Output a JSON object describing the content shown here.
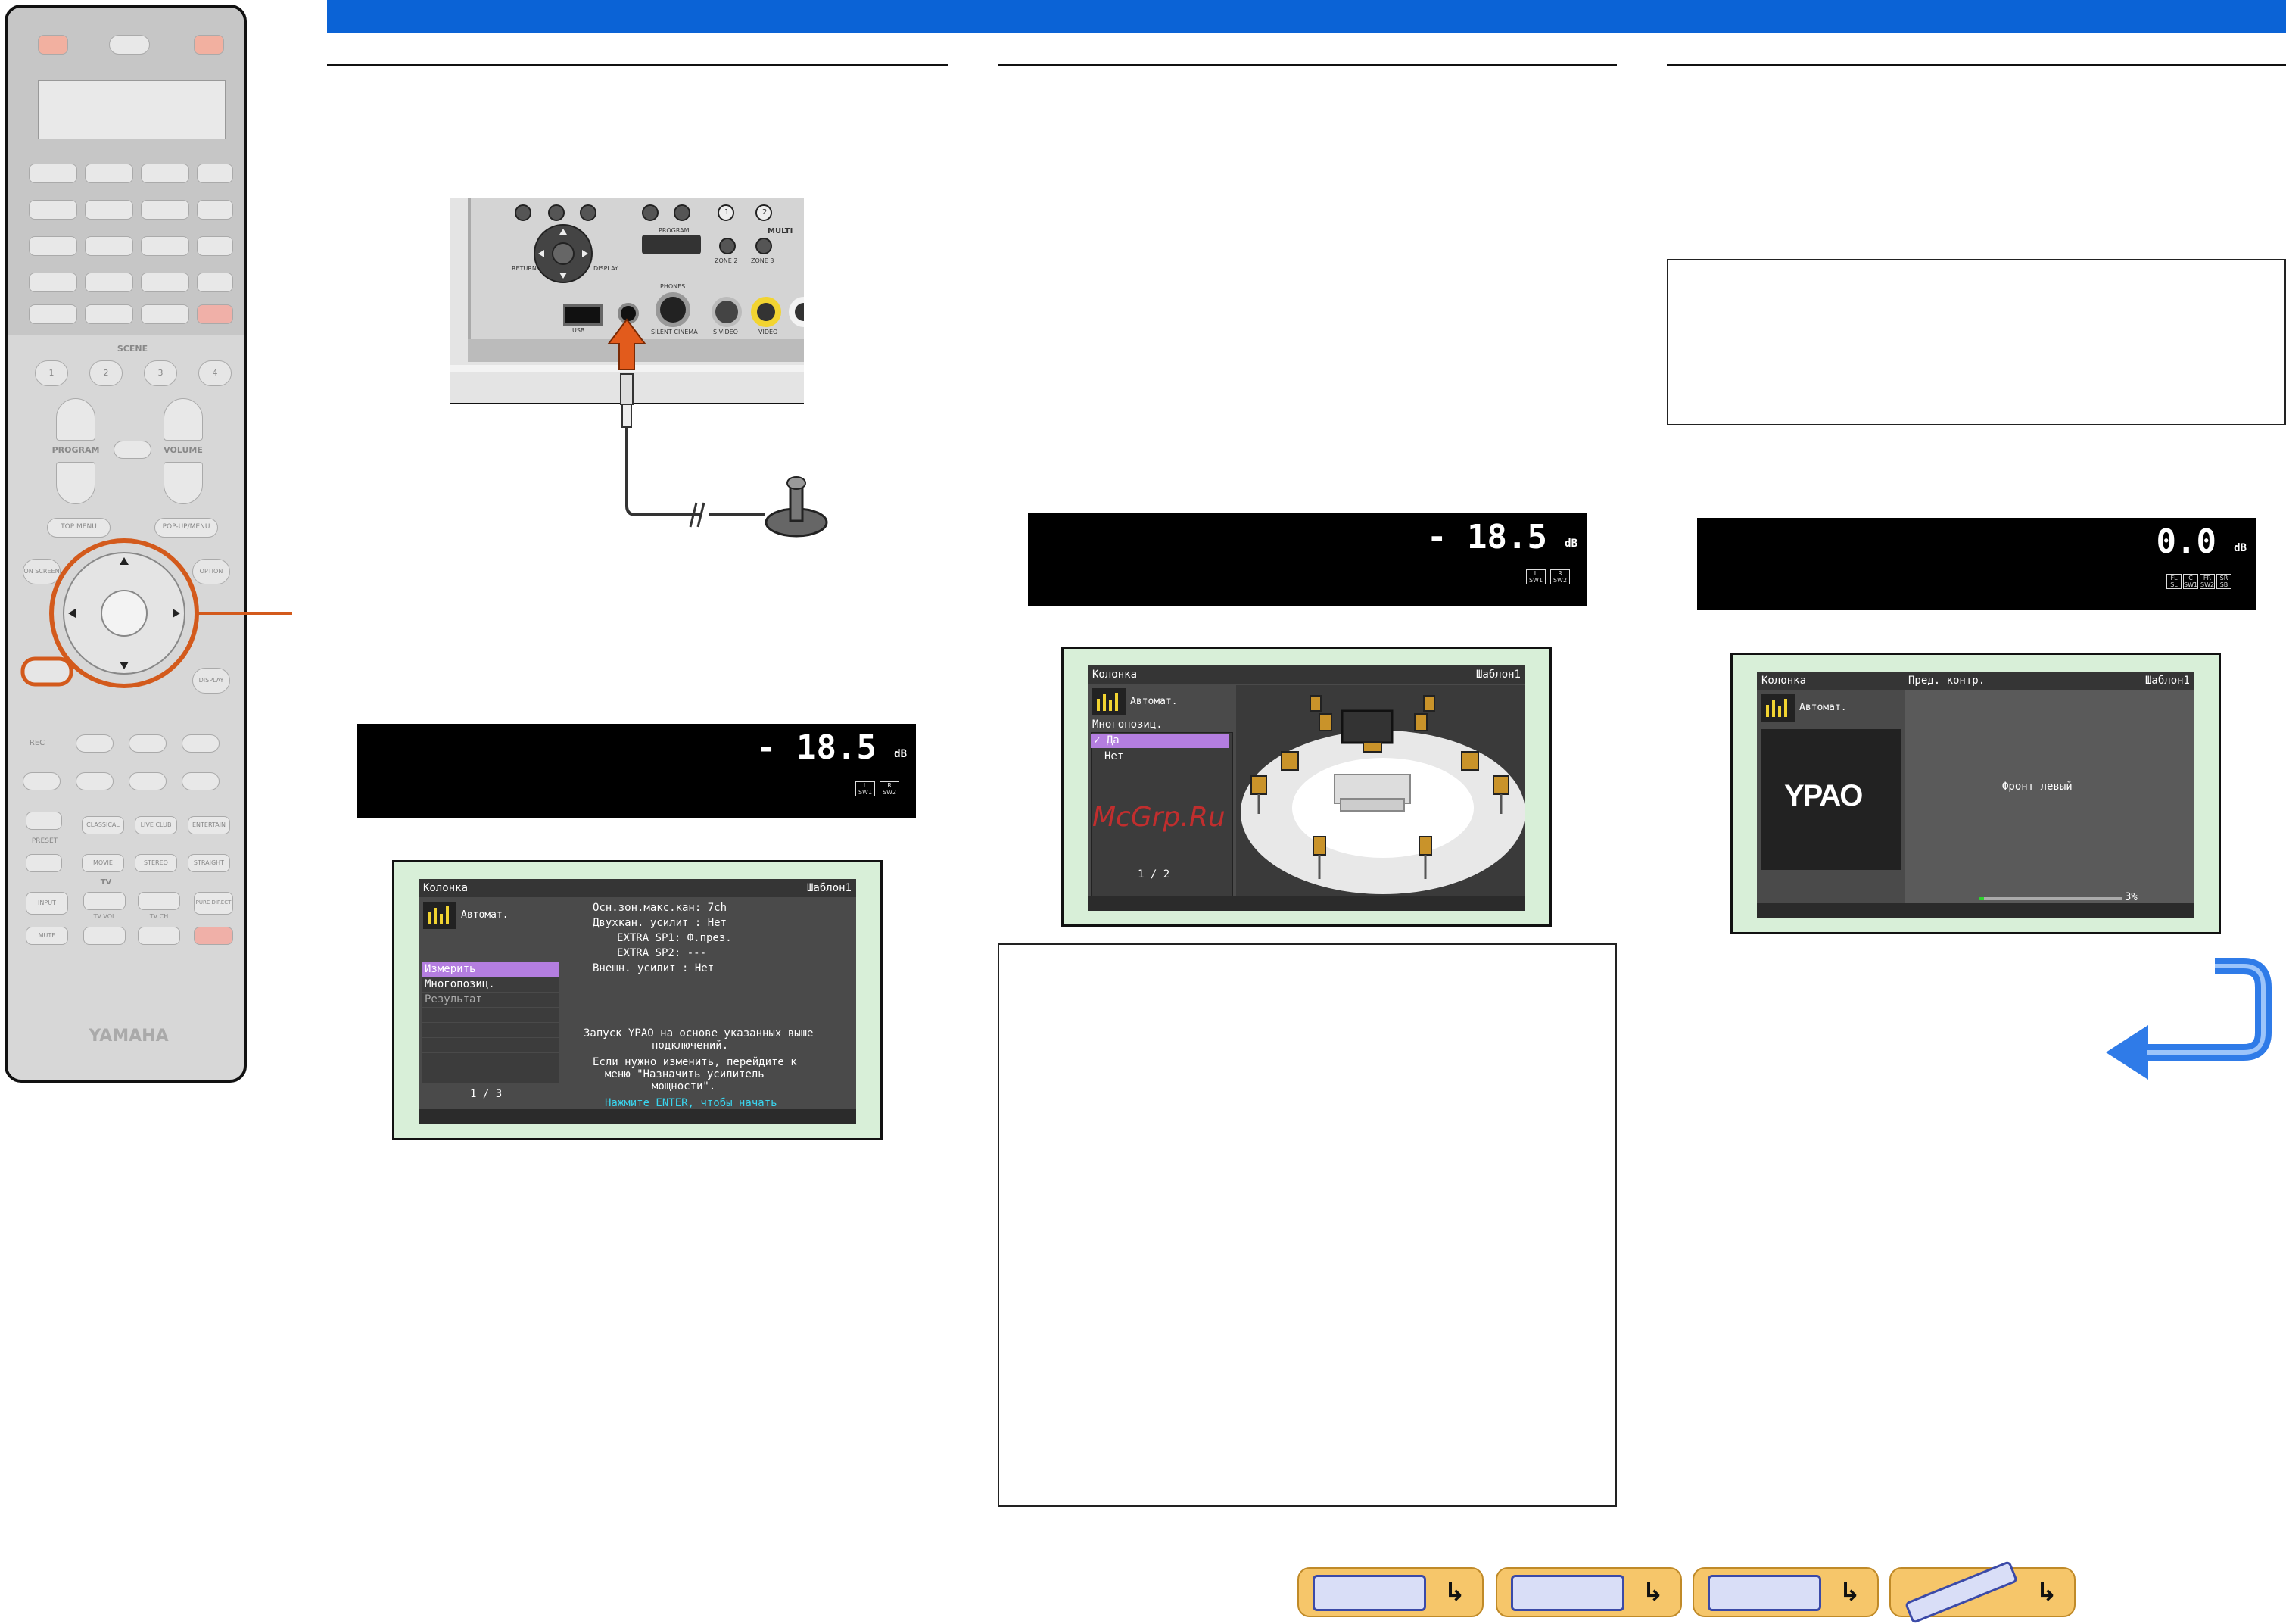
{
  "remote": {
    "scene_label": "SCENE",
    "scene_buttons": [
      "1",
      "2",
      "3",
      "4"
    ],
    "program_label": "PROGRAM",
    "volume_label": "VOLUME",
    "top_menu_label": "TOP MENU",
    "popup_menu_label": "POP-UP/MENU",
    "on_screen_label": "ON SCREEN",
    "option_label": "OPTION",
    "display_label": "DISPLAY",
    "rec_label": "REC",
    "preset_label": "PRESET",
    "mode_buttons": [
      "CLASSICAL",
      "LIVE CLUB",
      "ENTERTAIN",
      "MOVIE",
      "STEREO",
      "STRAIGHT"
    ],
    "tv_label": "TV",
    "input_label": "INPUT",
    "tv_vol_label": "TV VOL",
    "tv_ch_label": "TV CH",
    "pure_direct_label": "PURE DIRECT",
    "mute_label": "MUTE",
    "brand": "YAMAHA"
  },
  "panel": {
    "return_label": "RETURN",
    "display_label": "DISPLAY",
    "program_label": "PROGRAM",
    "multi_label": "MULTI",
    "zone2_label": "ZONE 2",
    "zone3_label": "ZONE 3",
    "usb_label": "USB",
    "phones_label": "PHONES",
    "silent_cinema_label": "SILENT CINEMA",
    "svideo_label": "S VIDEO",
    "video_label": "VIDEO",
    "num1": "1",
    "num2": "2"
  },
  "strip1": {
    "value": "- 18.5",
    "unit": "dB",
    "chips": [
      "L SW1",
      "R SW2"
    ]
  },
  "strip2": {
    "value": "- 18.5",
    "unit": "dB",
    "chips": [
      "L SW1",
      "R SW2"
    ]
  },
  "strip3": {
    "value": "0.0",
    "unit": "dB",
    "chips": [
      "FL SL",
      "C SW1",
      "FR SW2",
      "SR SB"
    ]
  },
  "osd1": {
    "title": "Колонка",
    "template": "Шаблон1",
    "mode": "Автомат.",
    "menu": [
      "Измерить",
      "Многопозиц.",
      "Результат"
    ],
    "page": "1 / 3",
    "info_lines": [
      "Осн.зон.макс.кан: 7ch",
      "Двухкан. усилит : Нет",
      "EXTRA SP1: Ф.през.",
      "EXTRA SP2: ---",
      "Внешн. усилит : Нет"
    ],
    "msg1": "Запуск YPAO на основе указанных выше",
    "msg2": "подключений.",
    "msg3": "Если нужно изменить, перейдите к",
    "msg4": "меню \"Назначить усилитель",
    "msg5": "мощности\".",
    "enter_msg": "Нажмите ENTER, чтобы начать"
  },
  "osd2": {
    "title": "Колонка",
    "template": "Шаблон1",
    "mode": "Автомат.",
    "multi": "Многопозиц.",
    "yes": "Да",
    "no": "Нет",
    "page": "1 / 2"
  },
  "osd3": {
    "title": "Колонка",
    "subtitle": "Пред. контр.",
    "template": "Шаблон1",
    "mode": "Автомат.",
    "logo": "YPAO",
    "status": "Фронт левый",
    "progress_text": "3%",
    "progress": 0.03
  },
  "watermark": "McGrp.Ru",
  "colors": {
    "topbar": "#0b63d6",
    "selected": "#b47ee0",
    "enter": "#39d6f0"
  }
}
